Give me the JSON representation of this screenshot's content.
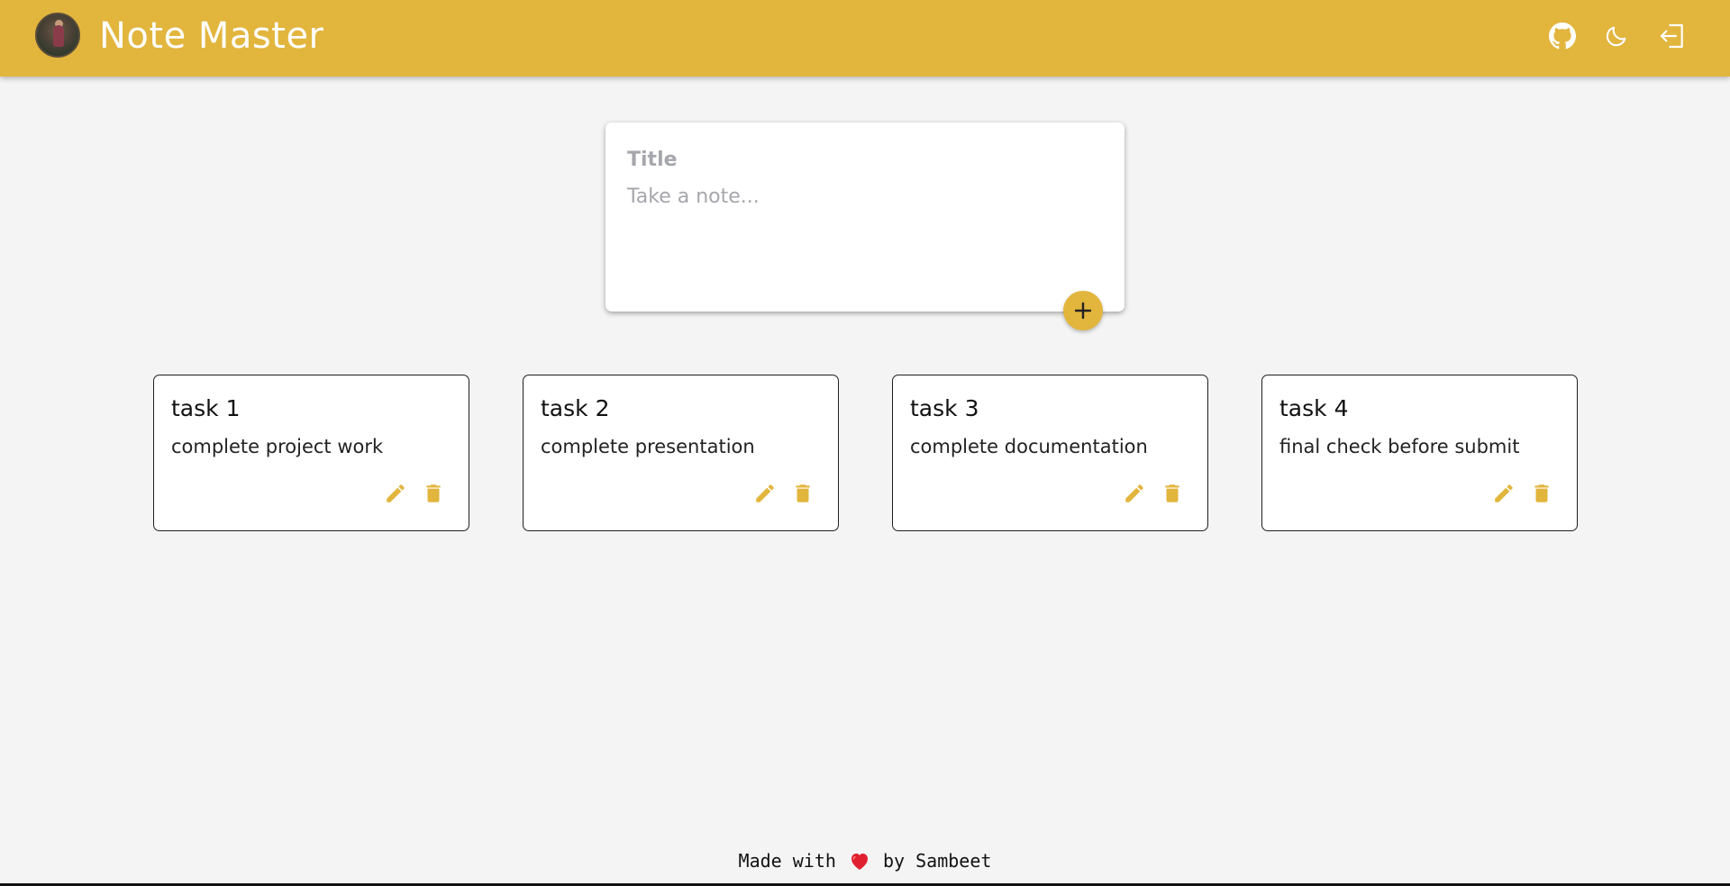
{
  "header": {
    "brand": "Note Master",
    "background_color": "#e2b53d",
    "icons": [
      "github-icon",
      "moon-icon",
      "logout-icon"
    ]
  },
  "composer": {
    "title_placeholder": "Title",
    "title_value": "",
    "note_placeholder": "Take a note...",
    "note_value": "",
    "add_icon": "plus-icon"
  },
  "notes": [
    {
      "title": "task 1",
      "content": "complete project work"
    },
    {
      "title": "task 2",
      "content": "complete presentation"
    },
    {
      "title": "task 3",
      "content": "complete documentation"
    },
    {
      "title": "task 4",
      "content": "final check before submit"
    }
  ],
  "note_actions": {
    "edit_icon": "pencil-icon",
    "delete_icon": "trash-icon",
    "color": "#e2b53d"
  },
  "footer": {
    "prefix": "Made with",
    "suffix": "by Sambeet",
    "heart_icon": "heart-icon",
    "heart_color": "#e0202f"
  }
}
